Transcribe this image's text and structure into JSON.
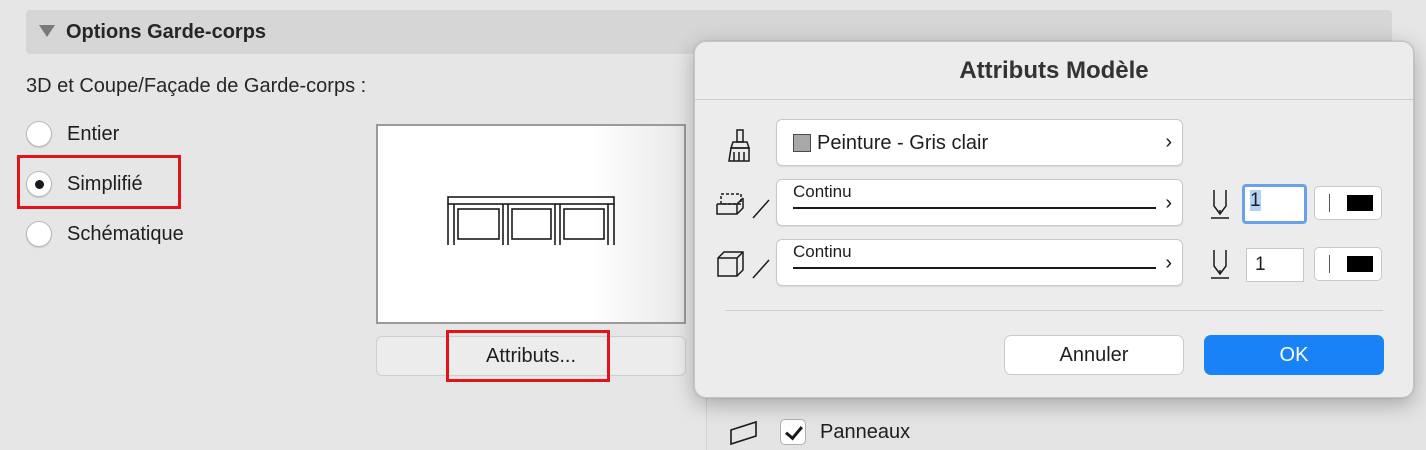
{
  "section": {
    "title": "Options Garde-corps",
    "subtitle": "3D et Coupe/Façade de Garde-corps :",
    "options": [
      {
        "label": "Entier",
        "selected": false
      },
      {
        "label": "Simplifié",
        "selected": true
      },
      {
        "label": "Schématique",
        "selected": false
      }
    ],
    "attributes_button": "Attributs...",
    "panels_checkbox": {
      "label": "Panneaux",
      "checked": true
    }
  },
  "dialog": {
    "title": "Attributs Modèle",
    "surface": {
      "label": "Peinture - Gris clair",
      "icon": "paint-brush-icon",
      "swatch_color": "#a8a8a8"
    },
    "cut_line": {
      "line_type": "Continu",
      "icon": "cut-surface-icon",
      "pen": "1",
      "pen_color": "#000000"
    },
    "outline_line": {
      "line_type": "Continu",
      "icon": "box-outline-icon",
      "pen": "1",
      "pen_color": "#000000"
    },
    "cancel_label": "Annuler",
    "ok_label": "OK"
  },
  "colors": {
    "accent": "#1a82f7",
    "highlight": "#e2131a",
    "focus_ring": "#6aa2e8"
  }
}
